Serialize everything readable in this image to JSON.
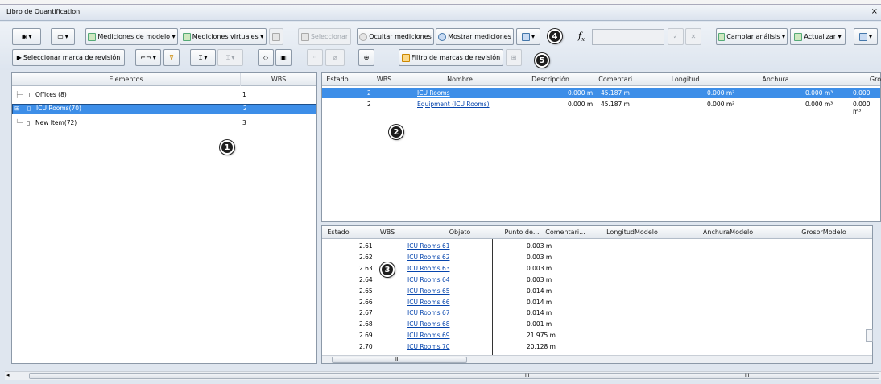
{
  "window": {
    "title": "Libro de Quantification",
    "close": "×"
  },
  "toolbar": {
    "model_takeoff": "Mediciones de modelo ▾",
    "virtual_takeoff": "Mediciones virtuales ▾",
    "select": "Seleccionar",
    "hide_takeoff": "Ocultar mediciones",
    "show_takeoff": "Mostrar mediciones",
    "change_analysis": "Cambiar análisis ▾",
    "update": "Actualizar ▾",
    "select_revision": "Seleccionar marca de revisión",
    "filter_revision": "Filtro de marcas de revisión",
    "fx": "f",
    "fx_sub": "x"
  },
  "callouts": [
    "1",
    "2",
    "3",
    "4",
    "5"
  ],
  "tree": {
    "headers": [
      "Elementos",
      "WBS"
    ],
    "items": [
      {
        "label": "Offices (8)",
        "wbs": "1"
      },
      {
        "label": "ICU Rooms(70)",
        "wbs": "2"
      },
      {
        "label": "New Item(72)",
        "wbs": "3"
      }
    ]
  },
  "items_grid": {
    "headers": [
      "Estado",
      "WBS",
      "Nombre",
      "Descripción",
      "Comentari...",
      "Longitud",
      "Anchura",
      "Gro"
    ],
    "rows": [
      {
        "wbs": "2",
        "name": "ICU Rooms",
        "v1": "0.000 m",
        "v2": "45.187 m",
        "v3": "0.000 m²",
        "v4": "0.000 m³",
        "v5": "0.000 m³"
      },
      {
        "wbs": "2",
        "name": "Equipment (ICU Rooms)",
        "v1": "0.000 m",
        "v2": "45.187 m",
        "v3": "0.000 m²",
        "v4": "0.000 m³",
        "v5": "0.000 m³"
      }
    ]
  },
  "objects_grid": {
    "headers": [
      "Estado",
      "WBS",
      "Objeto",
      "Punto de...",
      "Comentari...",
      "LongitudModelo",
      "AnchuraModelo",
      "GrosorModelo"
    ],
    "rows": [
      {
        "wbs": "2.61",
        "obj": "ICU Rooms 61",
        "val": "0.003 m"
      },
      {
        "wbs": "2.62",
        "obj": "ICU Rooms 62",
        "val": "0.003 m"
      },
      {
        "wbs": "2.63",
        "obj": "ICU Rooms 63",
        "val": "0.003 m"
      },
      {
        "wbs": "2.64",
        "obj": "ICU Rooms 64",
        "val": "0.003 m"
      },
      {
        "wbs": "2.65",
        "obj": "ICU Rooms 65",
        "val": "0.014 m"
      },
      {
        "wbs": "2.66",
        "obj": "ICU Rooms 66",
        "val": "0.014 m"
      },
      {
        "wbs": "2.67",
        "obj": "ICU Rooms 67",
        "val": "0.014 m"
      },
      {
        "wbs": "2.68",
        "obj": "ICU Rooms 68",
        "val": "0.001 m"
      },
      {
        "wbs": "2.69",
        "obj": "ICU Rooms 69",
        "val": "21.975 m"
      },
      {
        "wbs": "2.70",
        "obj": "ICU Rooms 70",
        "val": "20.128 m"
      }
    ]
  },
  "scroll": {
    "grip": "III"
  },
  "colors": {
    "selection": "#3d8ee8",
    "link": "#0645ad"
  }
}
